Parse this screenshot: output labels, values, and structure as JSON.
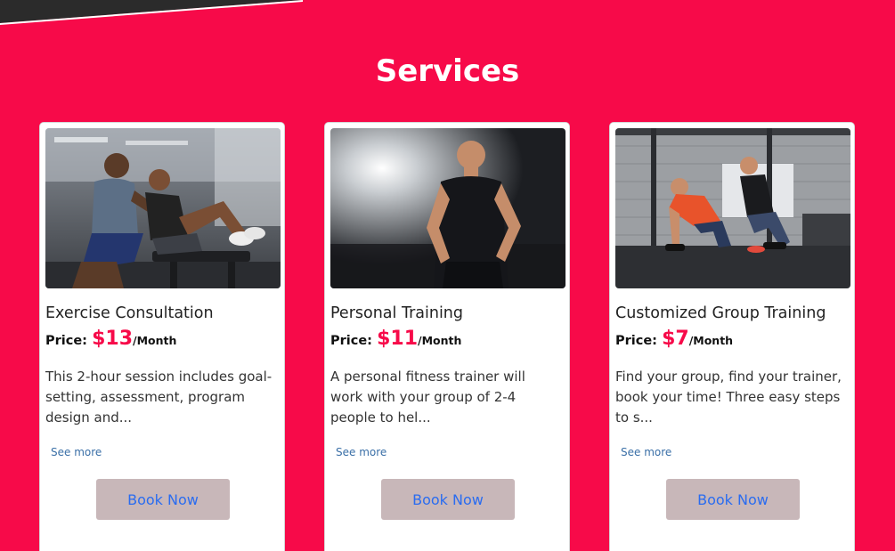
{
  "section": {
    "title": "Services"
  },
  "colors": {
    "background": "#f70a49",
    "price": "#f70a49",
    "button_bg": "#c8b7b9",
    "button_text": "#2a6cf0",
    "link": "#3a6fa7"
  },
  "services": [
    {
      "image": "trainer-assisting-sit-ups-photo",
      "title": "Exercise Consultation",
      "price_label": "Price:",
      "price": "$13",
      "period": "/Month",
      "description": "This 2-hour session includes goal-setting, assessment, program design and...",
      "see_more": "See more",
      "cta": "Book Now"
    },
    {
      "image": "personal-trainer-portrait-photo",
      "title": "Personal Training",
      "price_label": "Price:",
      "price": "$11",
      "period": "/Month",
      "description": "A personal fitness trainer will work with your group of 2-4 people to hel...",
      "see_more": "See more",
      "cta": "Book Now"
    },
    {
      "image": "group-dumbbell-training-photo",
      "title": "Customized Group Training",
      "price_label": "Price:",
      "price": "$7",
      "period": "/Month",
      "description": "Find your group, find your trainer, book your time! Three easy steps to s...",
      "see_more": "See more",
      "cta": "Book Now"
    }
  ]
}
